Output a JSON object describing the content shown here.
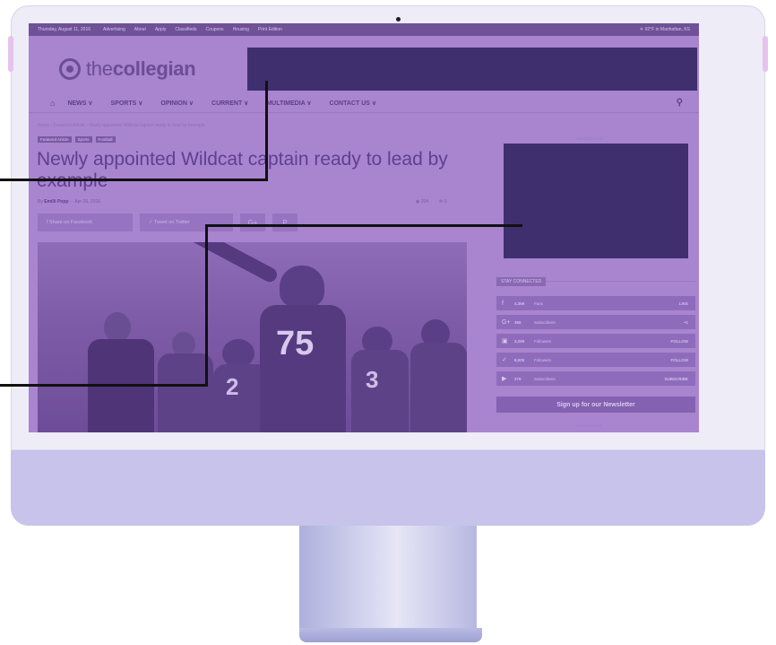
{
  "topbar": {
    "date": "Thursday, August 11, 2016",
    "links": [
      "Advertising",
      "About",
      "Apply",
      "Classifieds",
      "Coupons",
      "Housing",
      "Print Edition"
    ],
    "weather": "☀ 92°F in Manhattan, KS"
  },
  "logo": {
    "prefix": "the",
    "name": "collegian"
  },
  "nav": {
    "home_icon": "home-icon",
    "items": [
      "NEWS ∨",
      "SPORTS ∨",
      "OPINION ∨",
      "CURRENT ∨",
      "MULTIMEDIA ∨",
      "CONTACT US ∨"
    ],
    "search_icon": "search-icon"
  },
  "breadcrumb": "Home  ›  Featured Article  ›  Newly appointed Wildcat captain ready to lead by example",
  "tags": [
    "Featured Article",
    "Sports",
    "Football"
  ],
  "article": {
    "headline": "Newly appointed Wildcat captain ready to lead by example",
    "byline_prefix": "By",
    "author": "Emilli Popp",
    "date": "Apr 26, 2016",
    "views": "◉ 204",
    "comments": "✉ 0"
  },
  "share": {
    "facebook": "f    Share on Facebook",
    "twitter": "✓    Tweet on Twitter",
    "google": "G+",
    "pinterest": "P"
  },
  "photo": {
    "jersey_main": "75",
    "jersey_left": "2",
    "jersey_right": "3"
  },
  "sidebar": {
    "ad_label": "- Advertisement -",
    "stay_connected": "STAY CONNECTED",
    "social": [
      {
        "icon": "f",
        "count": "4,356",
        "label": "Fans",
        "action": "LIKE"
      },
      {
        "icon": "G+",
        "count": "365",
        "label": "Subscribers",
        "action": "+1"
      },
      {
        "icon": "▣",
        "count": "3,269",
        "label": "Followers",
        "action": "FOLLOW"
      },
      {
        "icon": "✓",
        "count": "8,005",
        "label": "Followers",
        "action": "FOLLOW"
      },
      {
        "icon": "▶",
        "count": "275",
        "label": "Subscribers",
        "action": "SUBSCRIBE"
      }
    ],
    "newsletter": "Sign up for our Newsletter",
    "ad_label_bottom": "- Advertisement -"
  },
  "colors": {
    "overlay": "#a984cf",
    "ad_block": "#3f2f6e",
    "chin": "#c7c3ea",
    "callout_line": "#111111"
  }
}
